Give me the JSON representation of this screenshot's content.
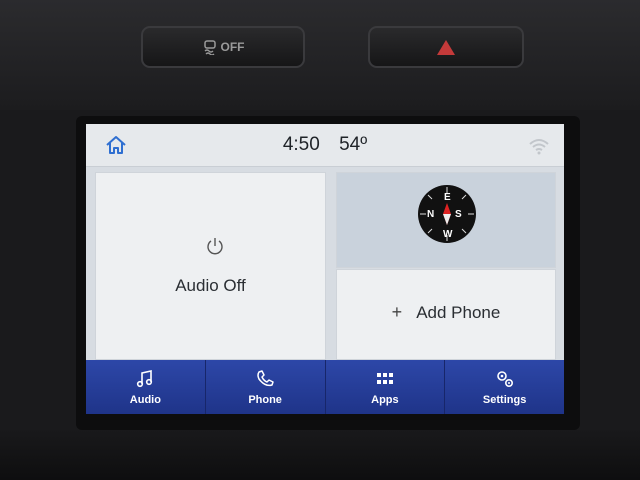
{
  "hardware": {
    "traction_label": "OFF"
  },
  "status_bar": {
    "time": "4:50",
    "temperature": "54º"
  },
  "tiles": {
    "audio": {
      "label": "Audio Off"
    },
    "compass": {
      "heading_letters": {
        "north": "N",
        "east": "E",
        "south": "S",
        "west": "W"
      }
    },
    "phone": {
      "plus": "+",
      "label": "Add Phone"
    }
  },
  "nav": {
    "items": [
      {
        "label": "Audio",
        "icon": "music-note-icon"
      },
      {
        "label": "Phone",
        "icon": "phone-icon"
      },
      {
        "label": "Apps",
        "icon": "grid-icon"
      },
      {
        "label": "Settings",
        "icon": "gears-icon"
      }
    ]
  },
  "colors": {
    "nav_bar": "#2d47a8",
    "screen_bg": "#d7dce2",
    "hazard": "#c43a3a"
  }
}
